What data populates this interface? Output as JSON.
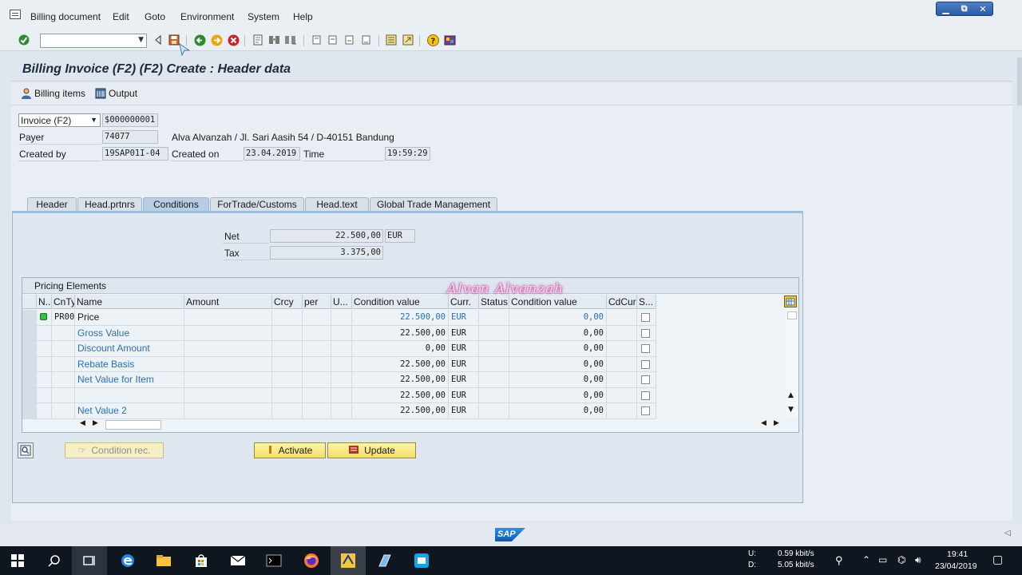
{
  "menu": {
    "items": [
      "Billing document",
      "Edit",
      "Goto",
      "Environment",
      "System",
      "Help"
    ]
  },
  "window_controls": [
    "▁",
    "⧉",
    "✕"
  ],
  "toolbar": {
    "command_field": ""
  },
  "title": "Billing Invoice (F2)  (F2) Create : Header data",
  "app_toolbar": {
    "billing_items": "Billing items",
    "output": "Output"
  },
  "header": {
    "doc_type": "Invoice (F2)",
    "doc_number": "$000000001",
    "payer_label": "Payer",
    "payer_value": "74077",
    "payer_address": "Alva Alvanzah / Jl. Sari Aasih 54 / D-40151 Bandung",
    "created_by_label": "Created by",
    "created_by_value": "19SAP01I-04",
    "created_on_label": "Created on",
    "created_on_value": "23.04.2019",
    "time_label": "Time",
    "time_value": "19:59:29"
  },
  "tabs": [
    "Header",
    "Head.prtnrs",
    "Conditions",
    "ForTrade/Customs",
    "Head.text",
    "Global Trade Management"
  ],
  "active_tab": "Conditions",
  "totals": {
    "net_label": "Net",
    "net_value": "22.500,00",
    "net_currency": "EUR",
    "tax_label": "Tax",
    "tax_value": "3.375,00"
  },
  "pricing": {
    "title": "Pricing Elements",
    "columns": [
      "N..",
      "CnTy",
      "Name",
      "Amount",
      "Crcy",
      "per",
      "U...",
      "Condition value",
      "Curr.",
      "Status",
      "Condition value",
      "CdCur",
      "S..."
    ],
    "rows": [
      {
        "cnty": "PR00",
        "name": "Price",
        "cond_value": "22.500,00",
        "curr": "EUR",
        "cond_value2": "0,00",
        "status_icon": true,
        "blue_values": true
      },
      {
        "cnty": "",
        "name": "Gross Value",
        "cond_value": "22.500,00",
        "curr": "EUR",
        "cond_value2": "0,00",
        "status_icon": false,
        "blue_values": false
      },
      {
        "cnty": "",
        "name": "Discount Amount",
        "cond_value": "0,00",
        "curr": "EUR",
        "cond_value2": "0,00",
        "status_icon": false,
        "blue_values": false
      },
      {
        "cnty": "",
        "name": "Rebate Basis",
        "cond_value": "22.500,00",
        "curr": "EUR",
        "cond_value2": "0,00",
        "status_icon": false,
        "blue_values": false
      },
      {
        "cnty": "",
        "name": "Net Value for Item",
        "cond_value": "22.500,00",
        "curr": "EUR",
        "cond_value2": "0,00",
        "status_icon": false,
        "blue_values": false
      },
      {
        "cnty": "",
        "name": "",
        "cond_value": "22.500,00",
        "curr": "EUR",
        "cond_value2": "0,00",
        "status_icon": false,
        "blue_values": false
      },
      {
        "cnty": "",
        "name": "Net Value 2",
        "cond_value": "22.500,00",
        "curr": "EUR",
        "cond_value2": "0,00",
        "status_icon": false,
        "blue_values": false
      }
    ]
  },
  "buttons": {
    "condition_rec": "Condition rec.",
    "activate": "Activate",
    "update": "Update"
  },
  "watermark": "Alvan Alvanzah",
  "statusbar": {
    "logo": "SAP"
  },
  "taskbar": {
    "net_up_label": "U:",
    "net_down_label": "D:",
    "net_up": "0.59 kbit/s",
    "net_down": "5.05 kbit/s",
    "time": "19:41",
    "date": "23/04/2019"
  },
  "colors": {
    "accent_blue": "#2a6fb3",
    "button_yellow": "#f2dd6a",
    "active_tab": "#b7cde4"
  }
}
